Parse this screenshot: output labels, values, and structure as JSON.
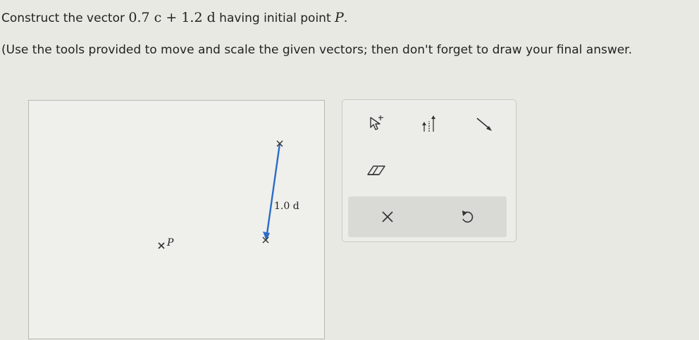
{
  "prompt": {
    "before": "Construct the vector ",
    "coef1": "0.7",
    "vec1": "c",
    "plus": "+",
    "coef2": "1.2",
    "vec2": "d",
    "after": " having initial point ",
    "point": "P",
    "end": "."
  },
  "instructions": "(Use the tools provided to move and scale the given vectors; then don't forget to draw your final answer.",
  "canvas": {
    "point_label": "P",
    "vector_label": "1.0 d",
    "point_marker": "×",
    "vector_color": "#2a6cc8"
  },
  "toolbox": {
    "tools": [
      "move-tool-icon",
      "scale-tool-icon",
      "draw-vector-icon",
      "eraser-icon"
    ],
    "actions": [
      "clear-icon",
      "undo-icon"
    ]
  }
}
